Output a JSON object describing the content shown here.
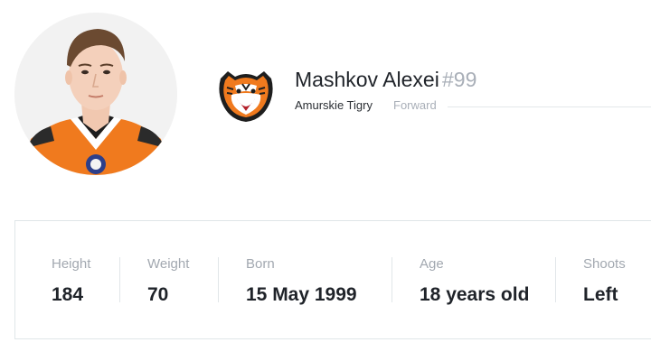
{
  "player": {
    "name": "Mashkov Alexei",
    "number": "#99",
    "team": "Amurskie Tigry",
    "position": "Forward"
  },
  "icons": {
    "avatar": "player-photo",
    "team_logo": "tiger-head-logo"
  },
  "colors": {
    "accent_orange": "#f07a1e",
    "muted_text": "#a9afb8",
    "border": "#dfe6e8"
  },
  "stats": [
    {
      "label": "Height",
      "value": "184"
    },
    {
      "label": "Weight",
      "value": "70"
    },
    {
      "label": "Born",
      "value": "15 May 1999"
    },
    {
      "label": "Age",
      "value": "18 years old"
    },
    {
      "label": "Shoots",
      "value": "Left"
    }
  ]
}
